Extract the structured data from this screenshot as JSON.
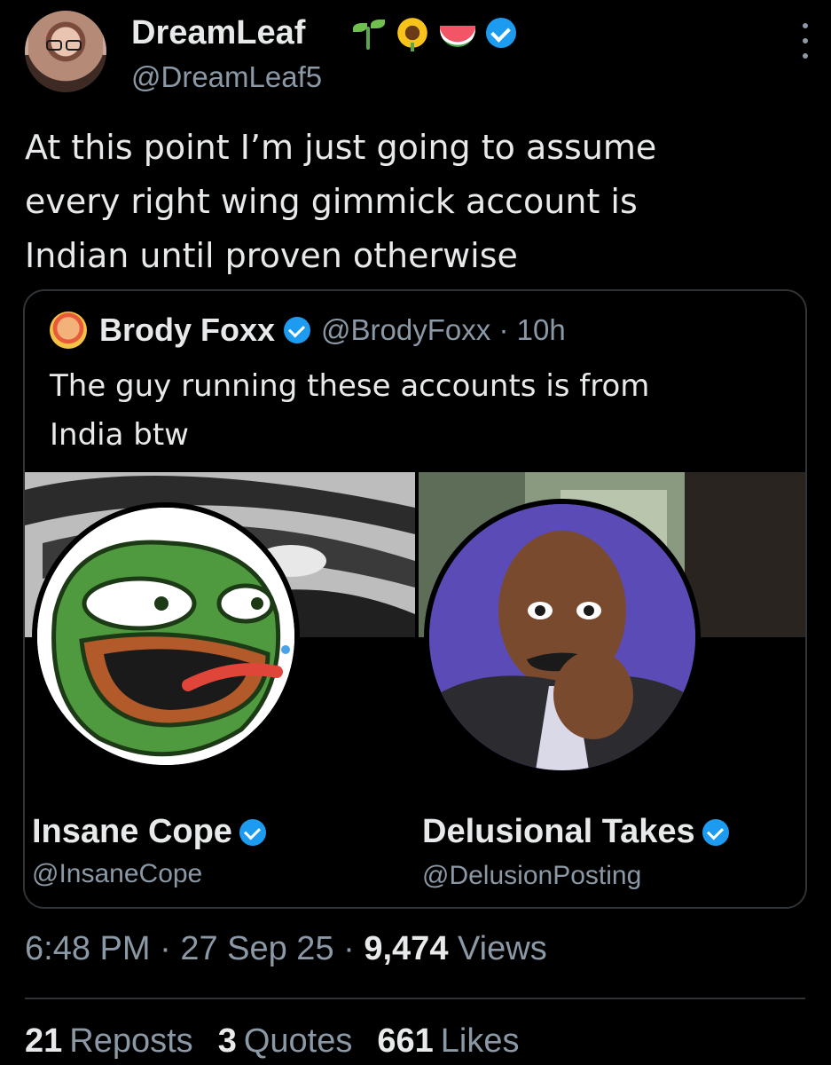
{
  "author": {
    "display_name": "DreamLeaf",
    "handle": "@DreamLeaf5",
    "emojis": [
      "seedling-emoji",
      "sunflower-emoji",
      "watermelon-emoji"
    ],
    "verified": true
  },
  "tweet": {
    "text_lines": [
      "At this point I’m just going to assume",
      "every right wing gimmick account is",
      "Indian until proven otherwise"
    ],
    "time": "6:48 PM",
    "date": "27 Sep 25",
    "views_count": "9,474",
    "views_label": "Views",
    "sep": "·"
  },
  "quote": {
    "name": "Brody Foxx",
    "handle": "@BrodyFoxx",
    "age": "10h",
    "sep": "·",
    "text_lines": [
      "The guy running these accounts is from",
      "India btw"
    ],
    "cards": [
      {
        "name": "Insane Cope",
        "handle": "@InsaneCope"
      },
      {
        "name": "Delusional Takes",
        "handle": "@DelusionPosting"
      }
    ]
  },
  "stats": {
    "reposts_count": "21",
    "reposts_label": "Reposts",
    "quotes_count": "3",
    "quotes_label": "Quotes",
    "likes_count": "661",
    "likes_label": "Likes"
  },
  "colors": {
    "accent": "#1d9bf0",
    "muted": "#8b98a5",
    "text": "#e7e9ea",
    "background": "#000000"
  }
}
